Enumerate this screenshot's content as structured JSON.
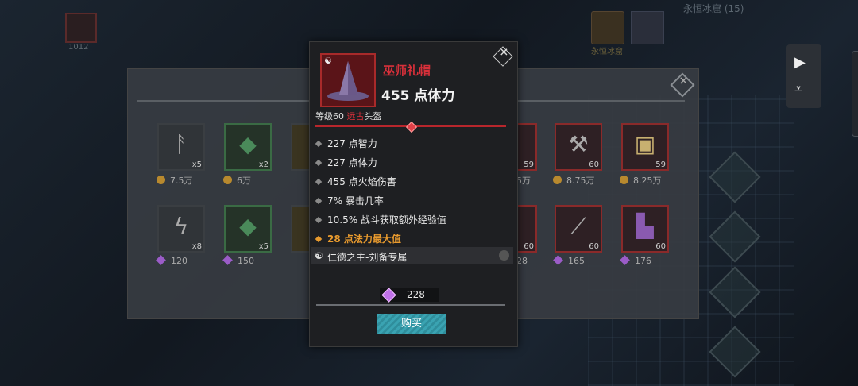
{
  "background": {
    "top_label": "永恒冰窟 (15)",
    "top_left_count": "1012",
    "top_mid_label": "永恒冰窟"
  },
  "shop": {
    "row1": [
      {
        "qty": "x5",
        "price": "7.5万",
        "currency": "coin",
        "glyph": "ᚨ"
      },
      {
        "qty": "x2",
        "price": "6万",
        "currency": "coin",
        "glyph": "◆"
      },
      {
        "qty": "",
        "price": "",
        "currency": "coin",
        "glyph": ""
      },
      {
        "qty": "59",
        "price": "5万",
        "currency": "coin",
        "glyph": ""
      },
      {
        "qty": "60",
        "price": "8.75万",
        "currency": "coin",
        "glyph": "⚒"
      },
      {
        "qty": "59",
        "price": "8.25万",
        "currency": "coin",
        "glyph": "▣"
      }
    ],
    "row2": [
      {
        "qty": "x8",
        "price": "120",
        "currency": "gem",
        "glyph": "ϟ"
      },
      {
        "qty": "x5",
        "price": "150",
        "currency": "gem",
        "glyph": "◆"
      },
      {
        "qty": "",
        "price": "",
        "currency": "gem",
        "glyph": ""
      },
      {
        "qty": "60",
        "price": "28",
        "currency": "gem",
        "glyph": ""
      },
      {
        "qty": "60",
        "price": "165",
        "currency": "gem",
        "glyph": "⟋"
      },
      {
        "qty": "60",
        "price": "176",
        "currency": "gem",
        "glyph": "▙"
      }
    ]
  },
  "tooltip": {
    "item_name": "巫师礼帽",
    "main_stat": "455 点体力",
    "level_prefix": "等级60 ",
    "level_class": "远古",
    "level_slot": "头盔",
    "attributes": [
      "227 点智力",
      "227 点体力",
      "455 点火焰伤害",
      "7% 暴击几率",
      "10.5% 战斗获取额外经验值"
    ],
    "special_attribute": "28 点法力最大值",
    "exclusive": "仁德之主-刘备专属",
    "info_icon": "i",
    "price": "228",
    "buy_label": "购买",
    "close_icon": "✕",
    "colors": {
      "accent_red": "#d8303a",
      "orange": "#e89a2e",
      "button": "#3aa3b2"
    }
  }
}
